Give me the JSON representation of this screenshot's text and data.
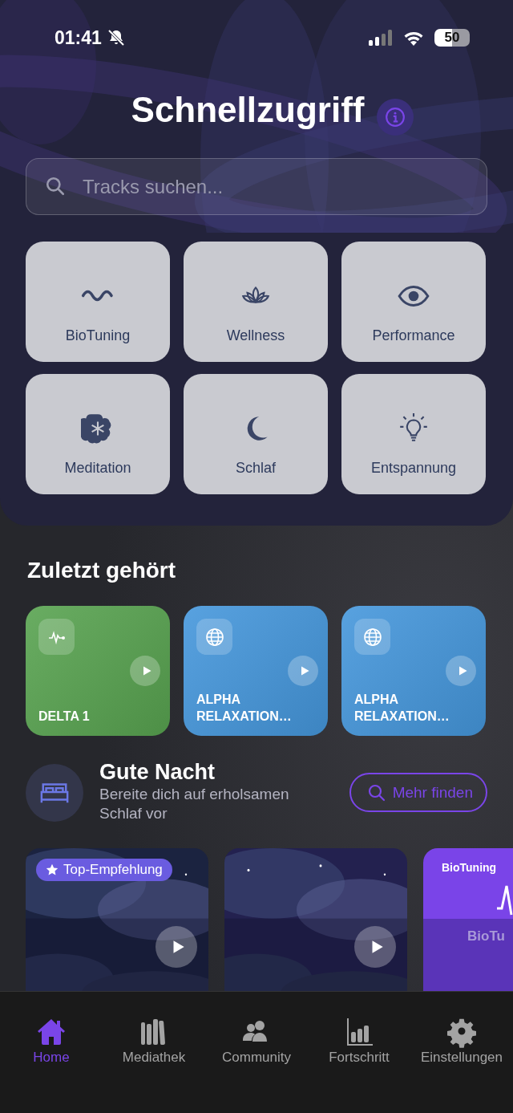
{
  "status_bar": {
    "time": "01:41",
    "battery": "50"
  },
  "header": {
    "title": "Schnellzugriff",
    "search": {
      "placeholder": "Tracks suchen..."
    }
  },
  "categories": [
    {
      "label": "BioTuning"
    },
    {
      "label": "Wellness"
    },
    {
      "label": "Performance"
    },
    {
      "label": "Meditation"
    },
    {
      "label": "Schlaf"
    },
    {
      "label": "Entspannung"
    }
  ],
  "recent": {
    "title": "Zuletzt gehört",
    "items": [
      {
        "title": "DELTA 1",
        "color": "#58a350",
        "kind": "pulse"
      },
      {
        "title": "ALPHA RELAXATION…",
        "color": "#4597dc",
        "kind": "globe"
      },
      {
        "title": "ALPHA RELAXATION…",
        "color": "#4597dc",
        "kind": "globe"
      }
    ]
  },
  "good_night": {
    "title": "Gute Nacht",
    "subtitle": "Bereite dich auf erholsamen Schlaf vor",
    "button": "Mehr finden",
    "items": [
      {
        "kind": "picture",
        "badge": "Top-Empfehlung"
      },
      {
        "kind": "picture"
      },
      {
        "kind": "promo",
        "tag": "BioTuning",
        "label": "BioTu"
      }
    ]
  },
  "tab_bar": [
    {
      "label": "Home",
      "selected": true
    },
    {
      "label": "Mediathek",
      "selected": false
    },
    {
      "label": "Community",
      "selected": false
    },
    {
      "label": "Fortschritt",
      "selected": false
    },
    {
      "label": "Einstellungen",
      "selected": false
    }
  ]
}
